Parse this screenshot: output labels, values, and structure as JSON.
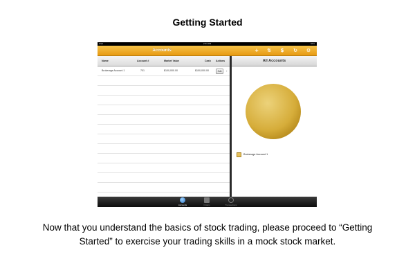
{
  "slide": {
    "title": "Getting Started",
    "caption": "Now that you understand the basics of stock trading, please proceed to “Getting Started” to exercise your trading skills in a mock stock market."
  },
  "device": {
    "status_bar": {
      "carrier": "iPad",
      "time": "2:53 PM",
      "battery": "84%"
    }
  },
  "app": {
    "nav_title": "Accounts",
    "nav_icons": [
      {
        "name": "add-icon",
        "glyph": "+"
      },
      {
        "name": "trade-icon",
        "glyph": "⇅"
      },
      {
        "name": "dollar-icon",
        "glyph": "$"
      },
      {
        "name": "refresh-icon",
        "glyph": "↻"
      },
      {
        "name": "settings-icon",
        "glyph": "⚙"
      }
    ],
    "colors": {
      "accent": "#f0a51e",
      "pie": "#d9b23c"
    },
    "table": {
      "headers": {
        "name": "Name",
        "account": "Account #",
        "market_value": "Market Value",
        "cash": "Cash",
        "actions": "Actions"
      },
      "rows": [
        {
          "name": "Brokerage Account 1",
          "account": "701",
          "market_value": "$100,000.00",
          "cash": "$100,000.00",
          "action": "Edit"
        }
      ]
    },
    "right_panel": {
      "title": "All Accounts",
      "legend": [
        {
          "label": "Brokerage Account 1",
          "color": "#e6c05c"
        }
      ]
    },
    "tabs": [
      {
        "label": "Accounts",
        "icon": "accounts-icon",
        "active": true
      },
      {
        "label": "Orders",
        "icon": "orders-icon",
        "active": false
      },
      {
        "label": "Transactions",
        "icon": "transactions-icon",
        "active": false
      }
    ]
  }
}
